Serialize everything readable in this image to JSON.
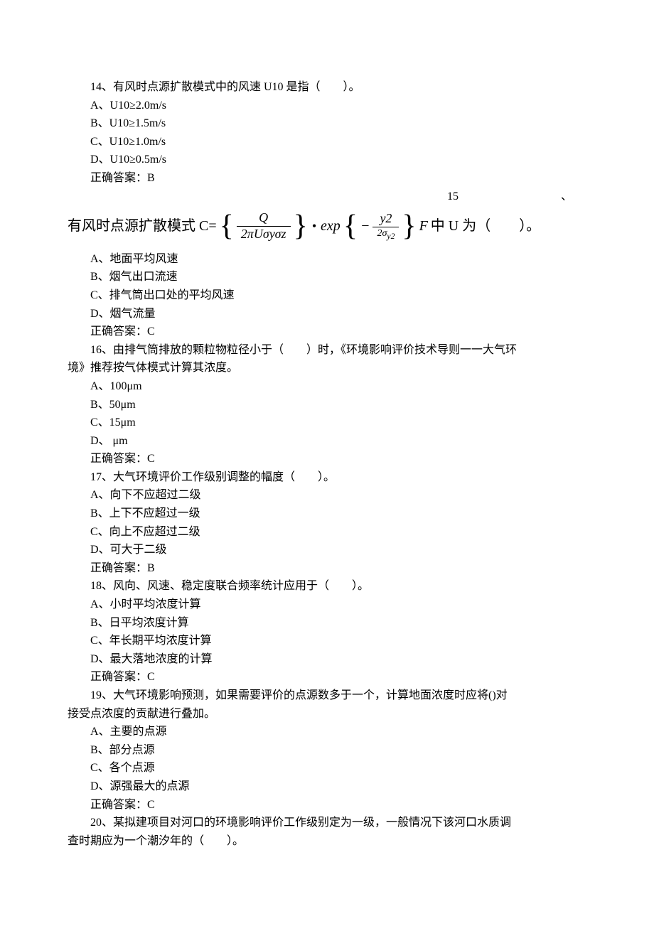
{
  "q14": {
    "text": "14、有风时点源扩散模式中的风速 U10 是指（　　）。",
    "opts": {
      "a": "A、U10≥2.0m/s",
      "b": "B、U10≥1.5m/s",
      "c": "C、U10≥1.0m/s",
      "d": "D、U10≥0.5m/s"
    },
    "answer": "正确答案：B"
  },
  "q15": {
    "num": "15",
    "dunhao": "、",
    "formula_prefix": "有风时点源扩散模式 C=",
    "frac1_num": "Q",
    "frac1_den": "2πUσyσz",
    "exp_label": "exp",
    "frac2_num": "y2",
    "frac2_den": "2σ",
    "frac2_den_sub": "y2",
    "formula_suffix_F": "F",
    "formula_suffix_text": "中 U 为（　　）。",
    "opts": {
      "a": "A、地面平均风速",
      "b": "B、烟气出口流速",
      "c": "C、排气筒出口处的平均风速",
      "d": "D、烟气流量"
    },
    "answer": "正确答案：C"
  },
  "q16": {
    "line1": "16、由排气筒排放的颗粒物粒径小于（　　）时，《环境影响评价技术导则一一大气环",
    "line2": "境》推荐按气体模式计算其浓度。",
    "opts": {
      "a": "A、100μm",
      "b": "B、50μm",
      "c": "C、15μm",
      "d": "D、 μm"
    },
    "answer": "正确答案：C"
  },
  "q17": {
    "text": "17、大气环境评价工作级别调整的幅度（　　）。",
    "opts": {
      "a": "A、向下不应超过二级",
      "b": "B、上下不应超过一级",
      "c": "C、向上不应超过二级",
      "d": "D、可大于二级"
    },
    "answer": "正确答案：B"
  },
  "q18": {
    "text": "18、风向、风速、稳定度联合频率统计应用于（　　）。",
    "opts": {
      "a": "A、小时平均浓度计算",
      "b": "B、日平均浓度计算",
      "c": "C、年长期平均浓度计算",
      "d": "D、最大落地浓度的计算"
    },
    "answer": "正确答案：C"
  },
  "q19": {
    "line1": "19、大气环境影响预测，如果需要评价的点源数多于一个，计算地面浓度时应将()对",
    "line2": "接受点浓度的贡献进行叠加。",
    "opts": {
      "a": "A、主要的点源",
      "b": "B、部分点源",
      "c": "C、各个点源",
      "d": "D、源强最大的点源"
    },
    "answer": "正确答案：C"
  },
  "q20": {
    "line1": "20、某拟建项目对河口的环境影响评价工作级别定为一级，一般情况下该河口水质调",
    "line2": "查时期应为一个潮汐年的（　　）。"
  }
}
